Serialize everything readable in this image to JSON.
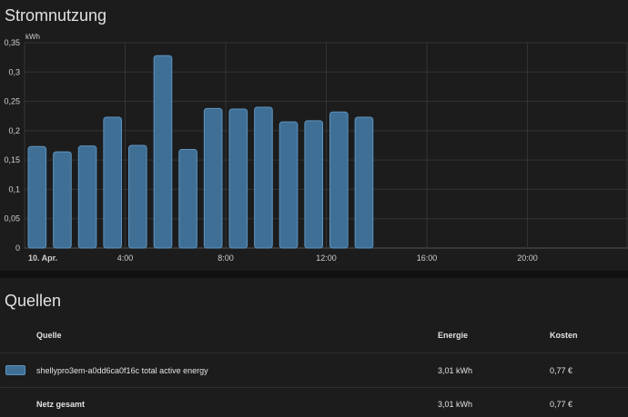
{
  "usage": {
    "title": "Stromnutzung"
  },
  "chart_data": {
    "type": "bar",
    "ylabel": "kWh",
    "ylim": [
      0,
      0.35
    ],
    "y_ticks": [
      "0",
      "0,05",
      "0,1",
      "0,15",
      "0,2",
      "0,25",
      "0,3",
      "0,35"
    ],
    "x_tick_labels": [
      {
        "hour": 0,
        "label": "10. Apr."
      },
      {
        "hour": 4,
        "label": "4:00"
      },
      {
        "hour": 8,
        "label": "8:00"
      },
      {
        "hour": 12,
        "label": "12:00"
      },
      {
        "hour": 16,
        "label": "16:00"
      },
      {
        "hour": 20,
        "label": "20:00"
      }
    ],
    "x_range_hours": [
      0,
      24
    ],
    "hours": [
      0,
      1,
      2,
      3,
      4,
      5,
      6,
      7,
      8,
      9,
      10,
      11,
      12,
      13
    ],
    "values": [
      0.173,
      0.164,
      0.174,
      0.223,
      0.175,
      0.328,
      0.168,
      0.238,
      0.237,
      0.24,
      0.215,
      0.217,
      0.232,
      0.223
    ],
    "bar_color": "#3f6f95",
    "bar_border_color": "#5d93bf",
    "grid": true
  },
  "sources": {
    "title": "Quellen",
    "headers": {
      "source": "Quelle",
      "energy": "Energie",
      "cost": "Kosten"
    },
    "rows": [
      {
        "name": "shellypro3em-a0dd6ca0f16c total active energy",
        "energy": "3,01 kWh",
        "cost": "0,77 €",
        "color": "#3f6f95"
      }
    ],
    "total": {
      "label": "Netz gesamt",
      "energy": "3,01 kWh",
      "cost": "0,77 €"
    }
  }
}
